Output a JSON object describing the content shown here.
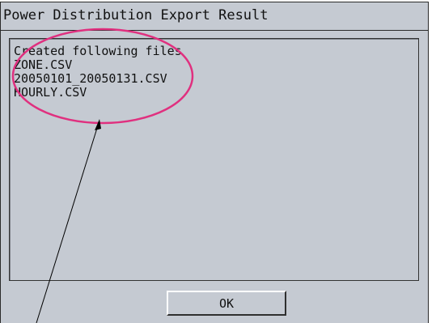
{
  "dialog": {
    "title": "Power Distribution Export Result",
    "result_lines": [
      "Created following files",
      "ZONE.CSV",
      "20050101_20050131.CSV",
      "HOURLY.CSV"
    ],
    "ok_label": "OK"
  },
  "annotation": {
    "color": "#e0307f"
  }
}
